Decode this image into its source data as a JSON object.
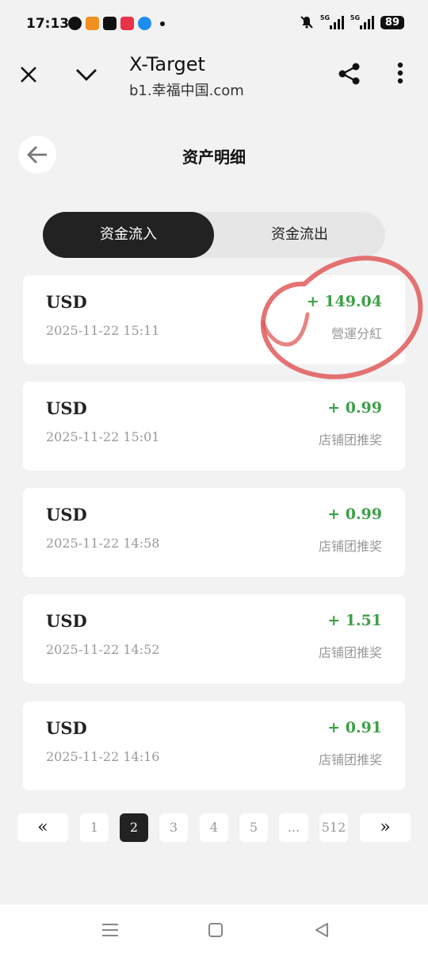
{
  "status_bar": {
    "time": "17:13",
    "network_1": "5G",
    "network_2": "5G",
    "battery": "89",
    "colors": {
      "app_1": "#f09020",
      "app_2": "#111111",
      "app_3": "#e8334a",
      "app_4": "#1e8df0"
    }
  },
  "browser": {
    "title": "X-Target",
    "url": "b1.幸福中国.com",
    "icons": [
      "close-icon",
      "chevron-down-icon",
      "share-icon",
      "more-icon"
    ]
  },
  "page": {
    "title": "资产明细"
  },
  "tabs": [
    {
      "label": "资金流入",
      "active": true
    },
    {
      "label": "资金流出",
      "active": false
    }
  ],
  "transactions": [
    {
      "currency": "USD",
      "datetime": "2025-11-22 15:11",
      "amount": "+ 149.04",
      "type": "營運分紅"
    },
    {
      "currency": "USD",
      "datetime": "2025-11-22 15:01",
      "amount": "+ 0.99",
      "type": "店铺团推奖"
    },
    {
      "currency": "USD",
      "datetime": "2025-11-22 14:58",
      "amount": "+ 0.99",
      "type": "店铺团推奖"
    },
    {
      "currency": "USD",
      "datetime": "2025-11-22 14:52",
      "amount": "+ 1.51",
      "type": "店铺团推奖"
    },
    {
      "currency": "USD",
      "datetime": "2025-11-22 14:16",
      "amount": "+ 0.91",
      "type": "店铺团推奖"
    }
  ],
  "pagination": {
    "first": "«",
    "pages": [
      "1",
      "2",
      "3",
      "4",
      "5",
      "...",
      "512"
    ],
    "current": "2",
    "last": "»"
  },
  "colors": {
    "accent": "#222222",
    "amount": "#3da048",
    "annotation": "#e05a5a"
  }
}
